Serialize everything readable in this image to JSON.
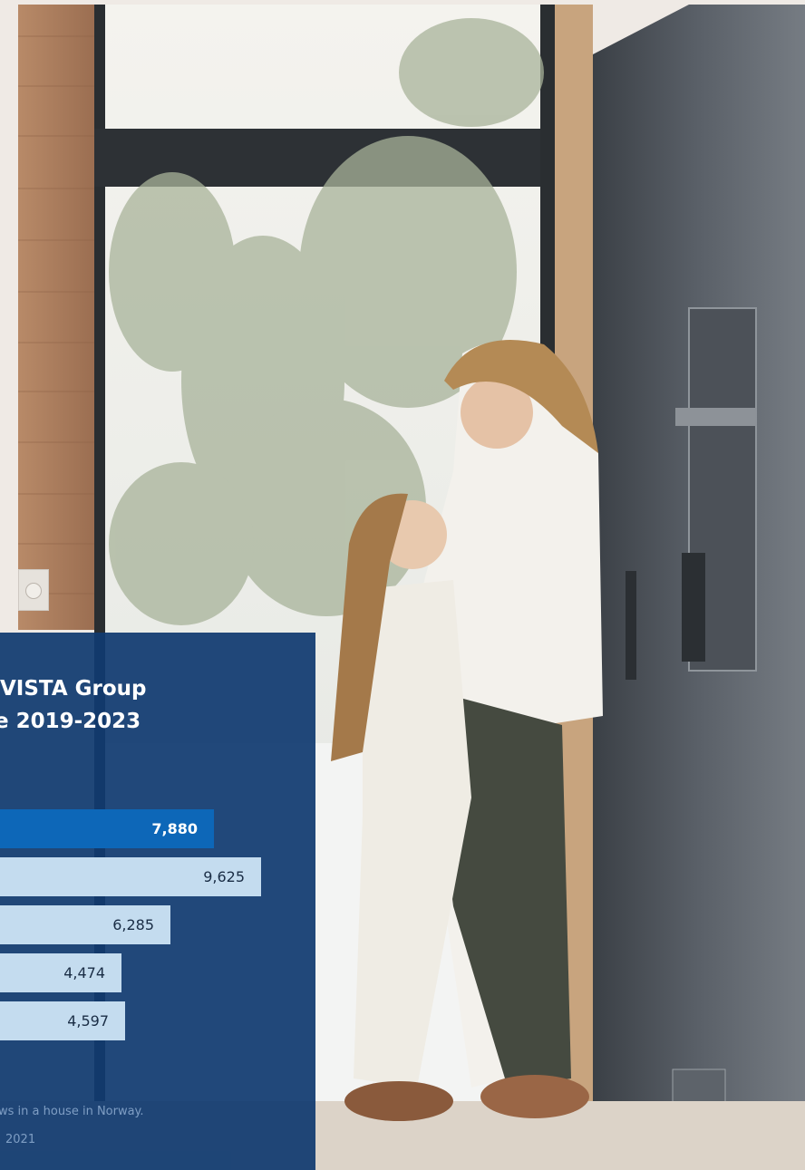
{
  "photo": {
    "description_icon": "photo-scene"
  },
  "panel": {
    "title_line_1": "VISTA Group",
    "title_line_2": "e 2019-2023",
    "background": "#103a70"
  },
  "chart_data": {
    "type": "bar",
    "orientation": "horizontal",
    "values": [
      7880,
      9625,
      6285,
      4474,
      4597
    ],
    "labels": [
      "7,880",
      "9,625",
      "6,285",
      "4,474",
      "4,597"
    ],
    "colors": {
      "highlight": "#0d67b8",
      "other": "#c4dcef"
    }
  },
  "captions": {
    "line_1": "ws in a house in Norway.",
    "line_2": "2021"
  }
}
